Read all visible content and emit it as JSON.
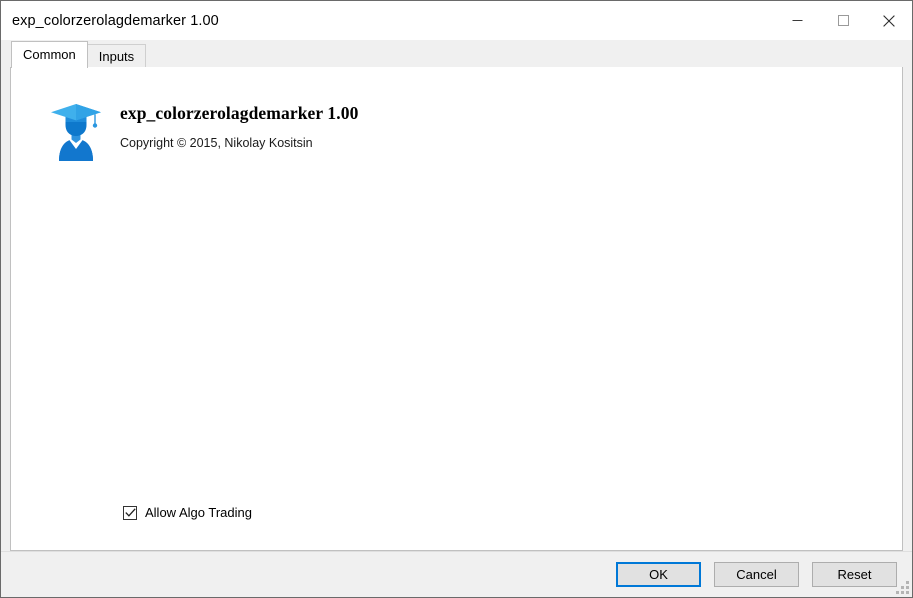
{
  "window": {
    "title": "exp_colorzerolagdemarker 1.00",
    "background_artifact": "........",
    "caption_buttons": [
      {
        "name": "minimize",
        "glyph": "minimize-icon",
        "tooltip": "Minimize"
      },
      {
        "name": "maximize",
        "glyph": "maximize-icon",
        "tooltip": "Maximize"
      },
      {
        "name": "close",
        "glyph": "close-icon",
        "tooltip": "Close"
      }
    ]
  },
  "tabs": [
    {
      "label": "Common",
      "selected": true
    },
    {
      "label": "Inputs",
      "selected": false
    }
  ],
  "common_tab": {
    "icon": "expert-advisor-graduation-cap-icon",
    "product_name": "exp_colorzerolagdemarker 1.00",
    "copyright": "Copyright © 2015, Nikolay Kositsin",
    "allow_algo_trading": {
      "label": "Allow Algo Trading",
      "checked": true,
      "check_glyph": "checkmark-icon"
    }
  },
  "footer": {
    "buttons": [
      {
        "label": "OK",
        "default": true
      },
      {
        "label": "Cancel",
        "default": false
      },
      {
        "label": "Reset",
        "default": false
      }
    ],
    "resize_grip": "resize-grip-icon"
  },
  "colors": {
    "accent": "#0078d7",
    "window_bg": "#f0f0f0",
    "content_bg": "#ffffff",
    "border": "#c0c0c0",
    "icon_blue_dark": "#0b6fc4",
    "icon_blue_mid": "#1c84d8",
    "icon_blue_light": "#3fa9e8"
  }
}
